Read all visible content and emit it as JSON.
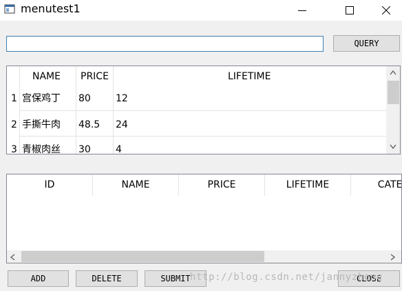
{
  "window": {
    "title": "menutest1"
  },
  "search": {
    "value": "",
    "placeholder": ""
  },
  "buttons": {
    "query": "QUERY",
    "add": "ADD",
    "delete": "DELETE",
    "submit": "SUBMIT",
    "close": "CLOSE"
  },
  "menu_table": {
    "columns": [
      "NAME",
      "PRICE",
      "LIFETIME"
    ],
    "rows": [
      {
        "num": "1",
        "name": "宫保鸡丁",
        "price": "80",
        "lifetime": "12"
      },
      {
        "num": "2",
        "name": "手撕牛肉",
        "price": "48.5",
        "lifetime": "24"
      },
      {
        "num": "3",
        "name": "青椒肉丝",
        "price": "30",
        "lifetime": "4"
      }
    ]
  },
  "order_table": {
    "columns": [
      "ID",
      "NAME",
      "PRICE",
      "LIFETIME",
      "CATEG"
    ]
  },
  "watermark": "http://blog.csdn.net/jannyzhong"
}
